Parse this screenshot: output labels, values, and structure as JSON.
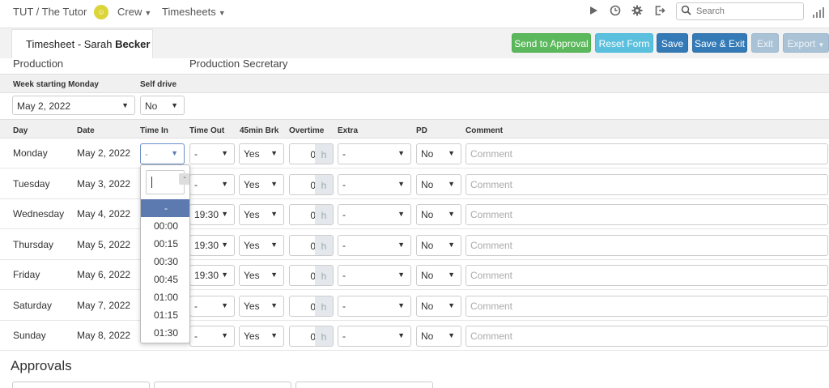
{
  "topbar": {
    "brand": "TUT / The Tutor",
    "crew_badge": "☺",
    "crew_label": "Crew",
    "timesheets_label": "Timesheets",
    "search_placeholder": "Search"
  },
  "header": {
    "tab_title_prefix": "Timesheet - Sarah ",
    "tab_title_bold": "Becker",
    "buttons": {
      "send": "Send to Approval",
      "reset": "Reset Form",
      "save": "Save",
      "save_exit": "Save & Exit",
      "exit": "Exit",
      "export": "Export"
    }
  },
  "production": {
    "department": "Production",
    "role": "Production Secretary"
  },
  "settings": {
    "week_label": "Week starting Monday",
    "self_drive_label": "Self drive",
    "week_value": "May 2, 2022",
    "self_drive_value": "No"
  },
  "columns": {
    "day": "Day",
    "date": "Date",
    "time_in": "Time In",
    "time_out": "Time Out",
    "brk": "45min Brk",
    "overtime": "Overtime",
    "extra": "Extra",
    "pd": "PD",
    "comment": "Comment"
  },
  "rows": [
    {
      "day": "Monday",
      "date": "May 2, 2022",
      "time_in": "-",
      "time_out": "-",
      "brk": "Yes",
      "ot": "0",
      "extra": "-",
      "pd": "No"
    },
    {
      "day": "Tuesday",
      "date": "May 3, 2022",
      "time_in": "",
      "time_out": "-",
      "brk": "Yes",
      "ot": "0",
      "extra": "-",
      "pd": "No"
    },
    {
      "day": "Wednesday",
      "date": "May 4, 2022",
      "time_in": "",
      "time_out": "19:30",
      "brk": "Yes",
      "ot": "0",
      "extra": "-",
      "pd": "No"
    },
    {
      "day": "Thursday",
      "date": "May 5, 2022",
      "time_in": "",
      "time_out": "19:30",
      "brk": "Yes",
      "ot": "0",
      "extra": "-",
      "pd": "No"
    },
    {
      "day": "Friday",
      "date": "May 6, 2022",
      "time_in": "",
      "time_out": "19:30",
      "brk": "Yes",
      "ot": "0",
      "extra": "-",
      "pd": "No"
    },
    {
      "day": "Saturday",
      "date": "May 7, 2022",
      "time_in": "",
      "time_out": "-",
      "brk": "Yes",
      "ot": "0",
      "extra": "-",
      "pd": "No"
    },
    {
      "day": "Sunday",
      "date": "May 8, 2022",
      "time_in": "",
      "time_out": "-",
      "brk": "Yes",
      "ot": "0",
      "extra": "-",
      "pd": "No"
    }
  ],
  "hour_unit": "h",
  "comment_placeholder": "Comment",
  "dropdown": {
    "clear": "-",
    "options": [
      "-",
      "00:00",
      "00:15",
      "00:30",
      "00:45",
      "01:00",
      "01:15",
      "01:30"
    ]
  },
  "approvals_title": "Approvals"
}
